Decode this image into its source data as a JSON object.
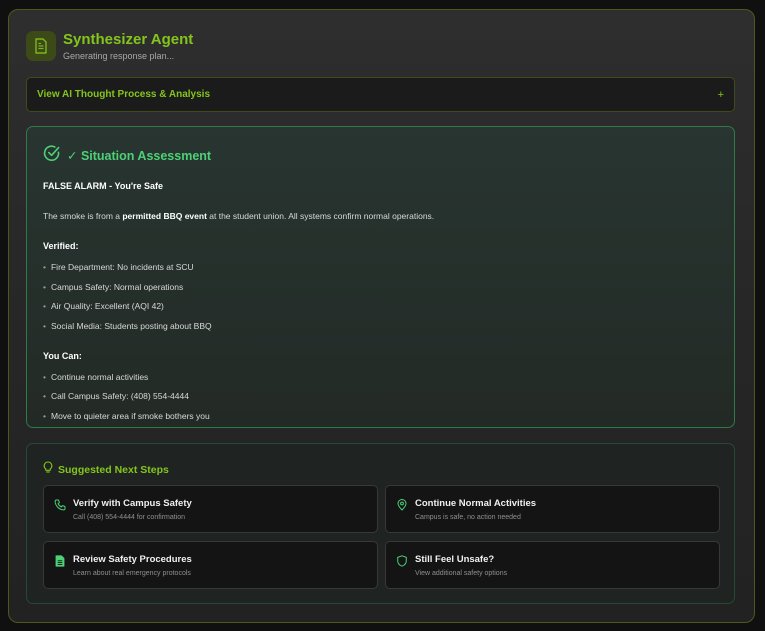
{
  "header": {
    "title": "Synthesizer Agent",
    "status": "Generating response plan..."
  },
  "thought_toggle": {
    "label": "View AI Thought Process & Analysis",
    "expand_symbol": "+"
  },
  "assessment": {
    "title": "✓ Situation Assessment",
    "headline": "FALSE ALARM - You're Safe",
    "summary": {
      "before": "The smoke is from a ",
      "emphasis": "permitted BBQ event",
      "after": " at the student union. All systems confirm normal operations."
    },
    "verified_heading": "Verified:",
    "verified_items": [
      "Fire Department: No incidents at SCU",
      "Campus Safety: Normal operations",
      "Air Quality: Excellent (AQI 42)",
      "Social Media: Students posting about BBQ"
    ],
    "can_heading": "You Can:",
    "can_items": [
      "Continue normal activities",
      "Call Campus Safety: (408) 554-4444",
      "Move to quieter area if smoke bothers you"
    ]
  },
  "next_steps": {
    "title": "Suggested Next Steps",
    "cards": [
      {
        "icon": "phone-icon",
        "title": "Verify with Campus Safety",
        "subtitle": "Call (408) 554-4444 for confirmation"
      },
      {
        "icon": "map-pin-icon",
        "title": "Continue Normal Activities",
        "subtitle": "Campus is safe, no action needed"
      },
      {
        "icon": "document-icon",
        "title": "Review Safety Procedures",
        "subtitle": "Learn about real emergency protocols"
      },
      {
        "icon": "shield-icon",
        "title": "Still Feel Unsafe?",
        "subtitle": "View additional safety options"
      }
    ]
  },
  "colors": {
    "accent": "#84c51d",
    "success": "#4cd177",
    "success_border": "#2f7a47"
  }
}
